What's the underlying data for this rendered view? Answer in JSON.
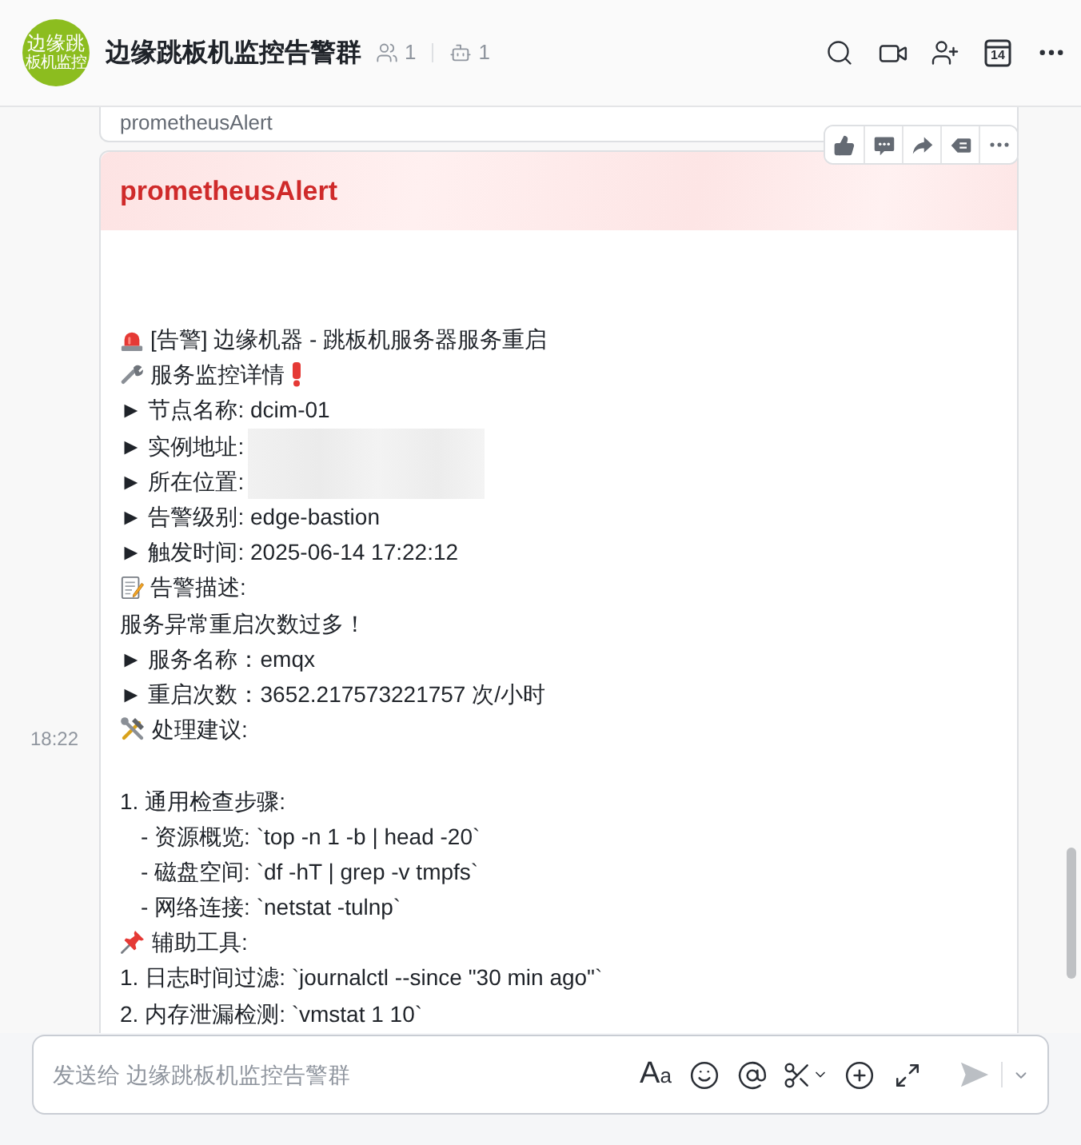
{
  "header": {
    "avatar": {
      "line_1": "边缘跳",
      "line_2": "板机监控"
    },
    "title": "边缘跳板机监控告警群",
    "member_count": "1",
    "bot_count": "1",
    "calendar_day": "14"
  },
  "previous_card": {
    "title": "prometheusAlert"
  },
  "alert_card": {
    "time": "18:22",
    "title": "prometheusAlert",
    "lines": [
      {
        "kind": "alert",
        "text": "[告警] 边缘机器 - 跳板机服务器服务重启"
      },
      {
        "kind": "details",
        "text": "服务监控详情"
      },
      {
        "kind": "text",
        "text": "► 节点名称: dcim-01"
      },
      {
        "kind": "redacted",
        "text": "► 实例地址:"
      },
      {
        "kind": "redacted",
        "text": "► 所在位置:"
      },
      {
        "kind": "text",
        "text": "► 告警级别: edge-bastion"
      },
      {
        "kind": "text",
        "text": "► 触发时间: 2025-06-14 17:22:12"
      },
      {
        "kind": "description",
        "text": "告警描述:"
      },
      {
        "kind": "text",
        "text": "服务异常重启次数过多！"
      },
      {
        "kind": "text",
        "text": "► 服务名称：emqx"
      },
      {
        "kind": "text",
        "text": "► 重启次数：3652.217573221757 次/小时"
      },
      {
        "kind": "advice",
        "text": "处理建议:"
      },
      {
        "kind": "blank"
      },
      {
        "kind": "text",
        "text": "1. 通用检查步骤:"
      },
      {
        "kind": "indent",
        "text": "- 资源概览: `top -n 1 -b | head -20`"
      },
      {
        "kind": "indent",
        "text": "- 磁盘空间: `df -hT | grep -v tmpfs`"
      },
      {
        "kind": "indent",
        "text": "- 网络连接: `netstat -tulnp`"
      },
      {
        "kind": "tools",
        "text": "辅助工具:"
      },
      {
        "kind": "text",
        "text": "1. 日志时间过滤: `journalctl --since \"30 min ago\"`"
      },
      {
        "kind": "text",
        "text": "2. 内存泄漏检测: `vmstat 1 10`"
      }
    ]
  },
  "composer": {
    "placeholder": "发送给 边缘跳板机监控告警群",
    "format_label": "Aa"
  }
}
